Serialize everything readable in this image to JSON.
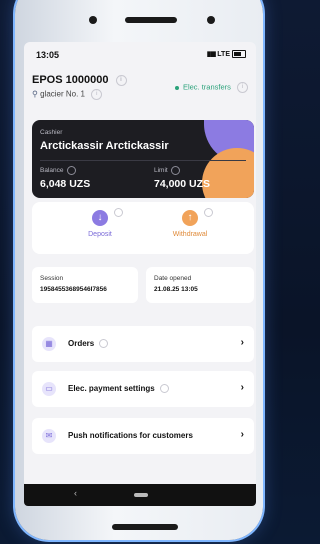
{
  "status_bar": {
    "time": "13:05",
    "network": "LTE"
  },
  "header": {
    "title": "EPOS 1000000",
    "location": "glacier No. 1",
    "elec_transfers": "Elec. transfers"
  },
  "card": {
    "role_label": "Cashier",
    "name": "Arctickassir Arctickassir",
    "balance_label": "Balance",
    "balance_value": "6,048 UZS",
    "limit_label": "Limit",
    "limit_value": "74,000 UZS",
    "colors": {
      "background": "#1d1d22",
      "accent_purple": "#8c7be2",
      "accent_orange": "#f1a35a"
    }
  },
  "actions": {
    "deposit": {
      "label": "Deposit",
      "icon": "arrow-down-icon",
      "color": "#8c7be2"
    },
    "withdrawal": {
      "label": "Withdrawal",
      "icon": "arrow-up-icon",
      "color": "#f1a35a"
    }
  },
  "session": {
    "session_label": "Session",
    "session_value": "19584553689546I7856",
    "date_label": "Date opened",
    "date_value": "21.08.25 13:05"
  },
  "menu": [
    {
      "label": "Orders",
      "icon": "orders-icon"
    },
    {
      "label": "Elec. payment settings",
      "icon": "card-icon"
    },
    {
      "label": "Push notifications for customers",
      "icon": "chat-icon"
    }
  ],
  "navigation": {
    "back_icon": "back-icon",
    "home_icon": "home-icon"
  }
}
